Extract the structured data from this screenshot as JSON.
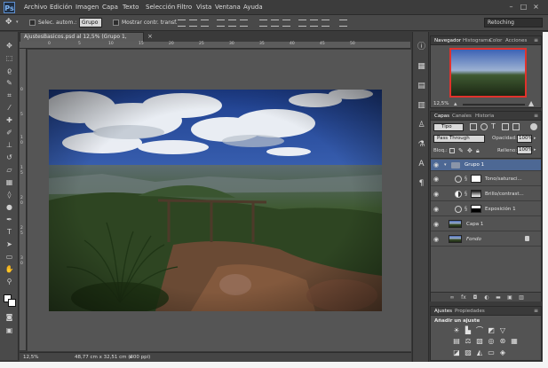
{
  "app": {
    "logo": "Ps"
  },
  "menu": [
    "Archivo",
    "Edición",
    "Imagen",
    "Capa",
    "Texto",
    "Selección",
    "Filtro",
    "Vista",
    "Ventana",
    "Ayuda"
  ],
  "window_controls": {
    "minimize": "–",
    "maximize": "□",
    "close": "×"
  },
  "options": {
    "auto_select_label": "Selec. autom.:",
    "auto_select_value": "Grupo",
    "show_transform_label": "Mostrar contr. transf.",
    "workspace": "Retoching"
  },
  "document": {
    "tab_title": "AjustesBasicos.psd al 12,5% (Grupo 1, RGB/8) *",
    "zoom": "12,5%",
    "size_info": "48,77 cm x 32,51 cm (300 ppi)",
    "ruler_h": [
      "0",
      "5",
      "10",
      "15",
      "20",
      "25",
      "30",
      "35",
      "40",
      "45",
      "50"
    ],
    "ruler_v": [
      "0",
      "5",
      "1",
      "0",
      "1",
      "5",
      "2",
      "0",
      "2",
      "5",
      "3",
      "0"
    ]
  },
  "navigator": {
    "tabs": [
      "Navegador",
      "Histograma",
      "Color",
      "Acciones"
    ],
    "zoom": "12,5%"
  },
  "layers_panel": {
    "tabs": [
      "Capas",
      "Canales",
      "Historia"
    ],
    "filter_kind": "Tipo",
    "blend_mode": "Pass Through",
    "opacity_label": "Opacidad:",
    "opacity_value": "100%",
    "lock_label": "Bloq.:",
    "fill_label": "Relleno:",
    "fill_value": "100%",
    "layers": [
      {
        "name": "Grupo 1",
        "type": "group",
        "selected": true
      },
      {
        "name": "Tono/saturaci...",
        "type": "adjustment",
        "mask": "white"
      },
      {
        "name": "Brillo/contrast...",
        "type": "adjustment",
        "mask": "gradient"
      },
      {
        "name": "Exposición 1",
        "type": "adjustment",
        "mask": "black-white"
      },
      {
        "name": "Capa 1",
        "type": "pixel"
      },
      {
        "name": "Fondo",
        "type": "background",
        "locked": true
      }
    ]
  },
  "adjustments_panel": {
    "tabs": [
      "Ajustes",
      "Propiedades"
    ],
    "heading": "Añadir un ajuste"
  },
  "colors": {
    "ui_bg": "#535353",
    "selected_layer": "#4d6894",
    "navigator_frame": "#e0322c"
  }
}
